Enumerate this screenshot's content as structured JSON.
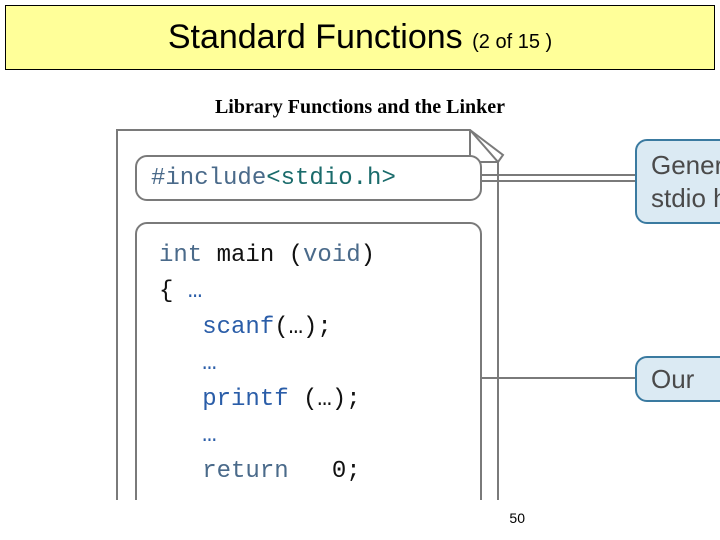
{
  "title": {
    "main": "Standard Functions ",
    "counter": "(2 of 15 )"
  },
  "subtitle": "Library Functions and the Linker",
  "code": {
    "include_gray": "#include ",
    "include_teal": "<stdio.h>",
    "l1_a": "int ",
    "l1_b": "main ",
    "l1_c": "(",
    "l1_d": "void",
    "l1_e": ")",
    "l2_a": "{ ",
    "l2_b": "…",
    "l3_a": "   scanf",
    "l3_b": "(…);",
    "l4": "   …",
    "l5_a": "   printf ",
    "l5_b": "(…);",
    "l6": "   …",
    "l7_a": "   return",
    "l7_b": "   0",
    "l7_c": ";"
  },
  "callouts": {
    "top_l1": "Gener",
    "top_l2": "stdio h",
    "bottom": "Our"
  },
  "page_number": "50"
}
